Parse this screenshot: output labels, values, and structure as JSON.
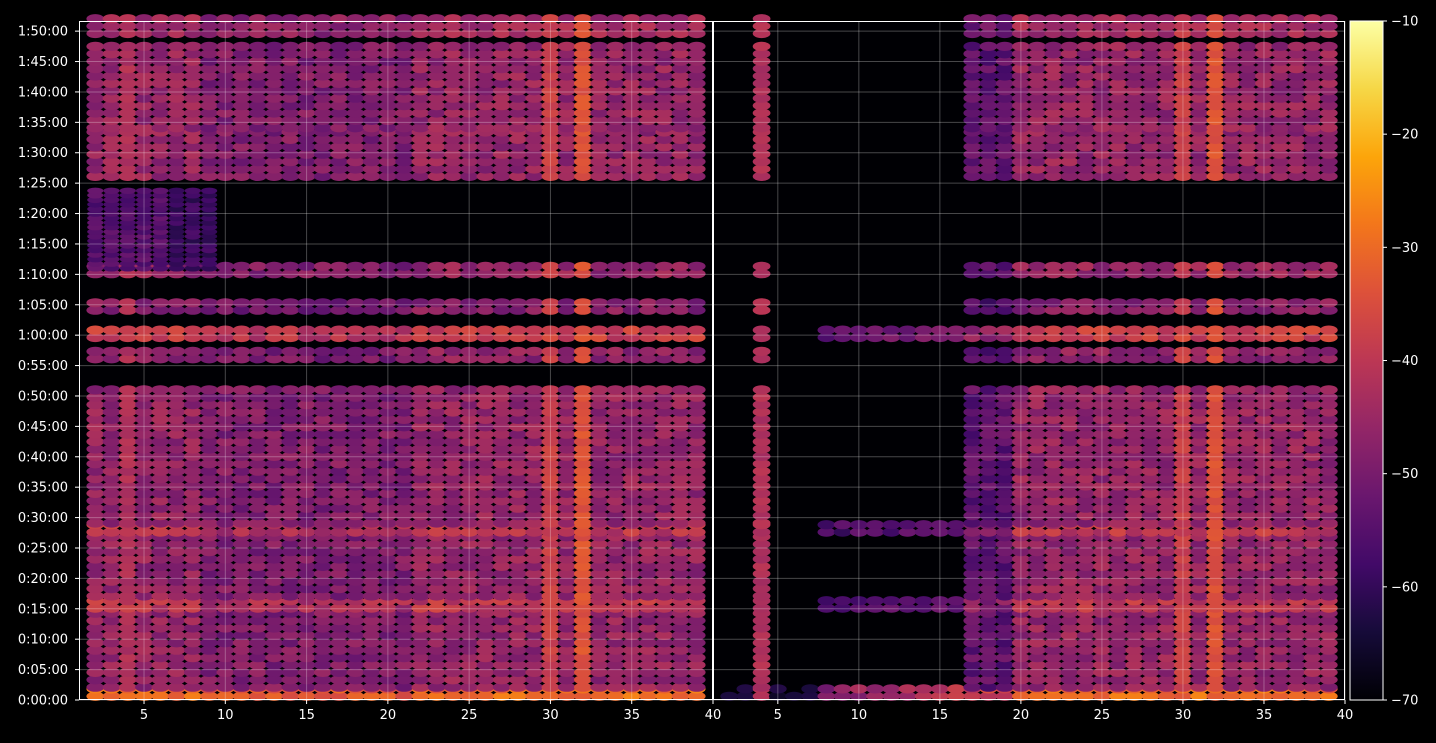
{
  "chart_data": {
    "type": "heatmap",
    "title": "",
    "xlabel": "",
    "ylabel": "",
    "colormap": "inferno",
    "background": "#000000",
    "grid": true,
    "panels": [
      {
        "name": "left",
        "xlim": [
          1,
          40
        ],
        "x_ticks": [
          5,
          10,
          15,
          20,
          25,
          30,
          35,
          40
        ],
        "x_tick_labels": [
          "5",
          "10",
          "15",
          "20",
          "25",
          "30",
          "35",
          "40"
        ],
        "onset_x": 1
      },
      {
        "name": "right",
        "xlim": [
          1,
          40
        ],
        "x_ticks": [
          5,
          10,
          15,
          20,
          25,
          30,
          35,
          40
        ],
        "x_tick_labels": [
          "5",
          "10",
          "15",
          "20",
          "25",
          "30",
          "35",
          "40"
        ],
        "onset_x": 20
      }
    ],
    "y_range_seconds": [
      0,
      6700
    ],
    "y_tick_labels": [
      "0:00:00",
      "0:05:00",
      "0:10:00",
      "0:15:00",
      "0:20:00",
      "0:25:00",
      "0:30:00",
      "0:35:00",
      "0:40:00",
      "0:45:00",
      "0:50:00",
      "0:55:00",
      "1:00:00",
      "1:05:00",
      "1:10:00",
      "1:15:00",
      "1:20:00",
      "1:25:00",
      "1:30:00",
      "1:35:00",
      "1:40:00",
      "1:45:00",
      "1:50:00"
    ],
    "active_time_bands": [
      {
        "start": "0:00:00",
        "end": "0:01:30",
        "level": -30
      },
      {
        "start": "0:01:30",
        "end": "0:14:30",
        "level": -46
      },
      {
        "start": "0:14:30",
        "end": "0:16:30",
        "level": -40
      },
      {
        "start": "0:16:30",
        "end": "0:27:00",
        "level": -46
      },
      {
        "start": "0:27:00",
        "end": "0:28:30",
        "level": -40
      },
      {
        "start": "0:28:30",
        "end": "0:51:00",
        "level": -46
      },
      {
        "start": "0:55:30",
        "end": "0:58:00",
        "level": -47
      },
      {
        "start": "0:59:00",
        "end": "1:00:30",
        "level": -38
      },
      {
        "start": "1:03:30",
        "end": "1:05:00",
        "level": -48
      },
      {
        "start": "1:09:30",
        "end": "1:11:00",
        "level": -46
      },
      {
        "start": "1:25:30",
        "end": "1:33:00",
        "level": -46
      },
      {
        "start": "1:33:30",
        "end": "1:47:30",
        "level": -46
      },
      {
        "start": "1:49:00",
        "end": "1:52:00",
        "level": -44
      }
    ],
    "hot_columns": [
      {
        "x": 32,
        "level": -34
      },
      {
        "x": 30,
        "level": -38
      },
      {
        "x": 4,
        "level": -42
      }
    ],
    "colorbar": {
      "min": -70,
      "max": -10,
      "ticks": [
        -70,
        -60,
        -50,
        -40,
        -30,
        -20,
        -10
      ],
      "tick_labels": [
        "−70",
        "−60",
        "−50",
        "−40",
        "−30",
        "−20",
        "−10"
      ]
    }
  }
}
